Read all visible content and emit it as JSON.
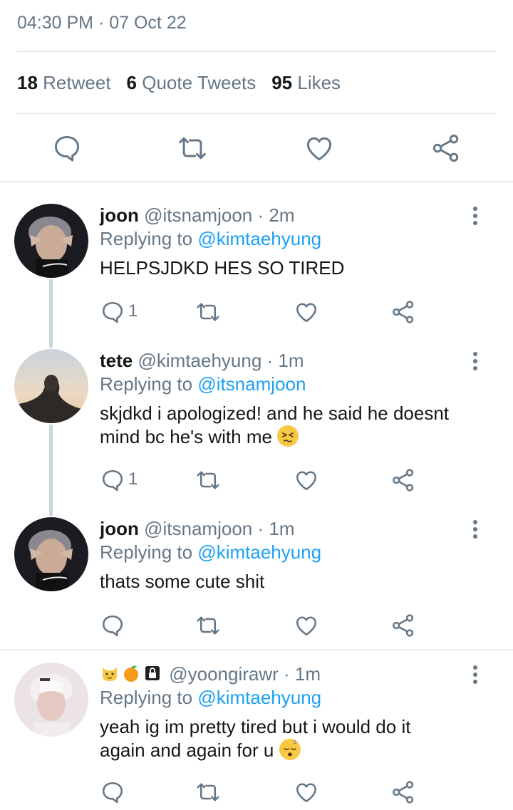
{
  "tweet": {
    "timestamp": "04:30 PM · 07 Oct 22",
    "stats": [
      {
        "count": "18",
        "label": "Retweet"
      },
      {
        "count": "6",
        "label": "Quote Tweets"
      },
      {
        "count": "95",
        "label": "Likes"
      }
    ],
    "actions": [
      "reply-icon",
      "retweet-icon",
      "like-icon",
      "share-icon"
    ]
  },
  "colors": {
    "text": "#14171a",
    "secondary": "#657786",
    "link": "#1da1f2",
    "divider": "#e6ecf0",
    "thread_line": "#ccd6dd"
  },
  "replies": [
    {
      "name": "joon",
      "handle": "@itsnamjoon",
      "time": "· 2m",
      "replying_prefix": "Replying to",
      "replying_to": "@kimtaehyung",
      "text": "HELPSJDKD HES SO TIRED",
      "reply_count": "1"
    },
    {
      "name": "tete",
      "handle": "@kimtaehyung",
      "time": "· 1m",
      "replying_prefix": "Replying to",
      "replying_to": "@itsnamjoon",
      "text_line1": "skjdkd i apologized! and he said he doesnt",
      "text_line2": "mind bc he's with me",
      "emoji": "persevering-face-emoji",
      "reply_count": "1"
    },
    {
      "name": "joon",
      "handle": "@itsnamjoon",
      "time": "· 1m",
      "replying_prefix": "Replying to",
      "replying_to": "@kimtaehyung",
      "text": "thats some cute shit",
      "reply_count": ""
    },
    {
      "name_emojis": [
        "cat-face-emoji",
        "tangerine-emoji",
        "lock-emoji"
      ],
      "handle": "@yoongirawr",
      "time": "· 1m",
      "replying_prefix": "Replying to",
      "replying_to": "@kimtaehyung",
      "text_line1": "yeah ig im pretty tired but i would do it",
      "text_line2": "again and again for u",
      "emoji": "sleeping-face-emoji",
      "reply_count": ""
    }
  ]
}
